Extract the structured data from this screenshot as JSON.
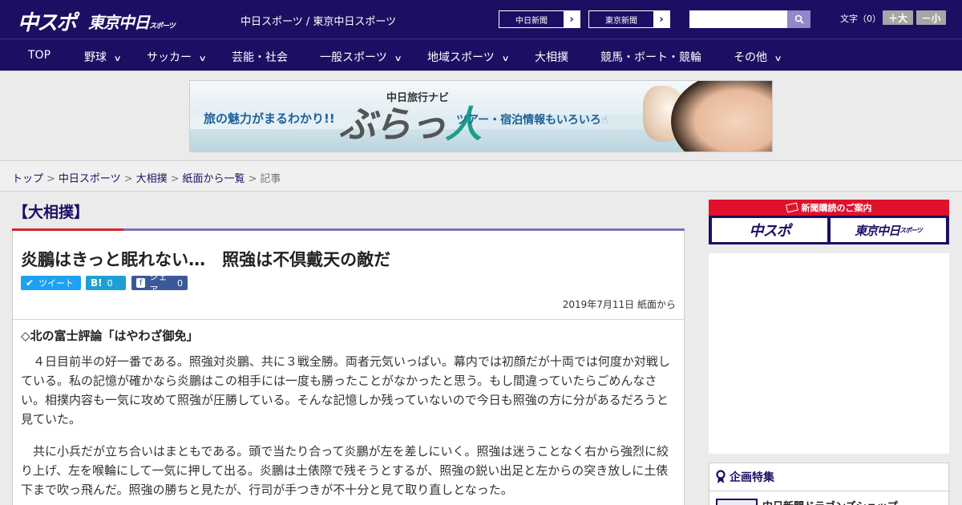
{
  "header": {
    "logo_chuspo": "中スポ",
    "logo_tokyo": "東京中日",
    "logo_tokyo_small": "スポーツ",
    "site_links": "中日スポーツ / 東京中日スポーツ",
    "btn_chunichi": "中日新聞",
    "btn_tokyo": "東京新聞",
    "search_placeholder": "",
    "moji_label": "文字（0）",
    "size_up": "＋大",
    "size_down": "－小"
  },
  "nav": {
    "items": [
      {
        "label": "TOP",
        "dropdown": false
      },
      {
        "label": "野球",
        "dropdown": true
      },
      {
        "label": "サッカー",
        "dropdown": true
      },
      {
        "label": "芸能・社会",
        "dropdown": false
      },
      {
        "label": "一般スポーツ",
        "dropdown": true
      },
      {
        "label": "地域スポーツ",
        "dropdown": true
      },
      {
        "label": "大相撲",
        "dropdown": false
      },
      {
        "label": "競馬・ボート・競輪",
        "dropdown": false
      },
      {
        "label": "その他",
        "dropdown": true
      }
    ]
  },
  "banner": {
    "subtitle": "中日旅行ナビ",
    "left_text": "旅の魅力がまるわかり!!",
    "logo_text": "ぶらっ",
    "logo_hito": "人",
    "right_text": "ツアー・宿泊情報もいろいろ"
  },
  "breadcrumb": {
    "items": [
      "トップ",
      "中日スポーツ",
      "大相撲",
      "紙面から一覧"
    ],
    "current": "記事"
  },
  "article": {
    "section": "【大相撲】",
    "headline": "炎鵬はきっと眠れない…　照強は不倶戴天の敵だ",
    "share_tweet": "ツイート",
    "share_hatena_icon": "B!",
    "share_hatena_count": "0",
    "share_fb_label": "シェア",
    "share_fb_count": "0",
    "date": "2019年7月11日 紙面から",
    "sub_heading": "◇北の富士評論「はやわざ御免」",
    "paragraphs": [
      "４日目前半の好一番である。照強対炎鵬、共に３戦全勝。両者元気いっぱい。幕内では初顔だが十両では何度か対戦している。私の記憶が確かなら炎鵬はこの相手には一度も勝ったことがなかったと思う。もし間違っていたらごめんなさい。相撲内容も一気に攻めて照強が圧勝している。そんな記憶しか残っていないので今日も照強の方に分があるだろうと見ていた。",
      "共に小兵だが立ち合いはまともである。頭で当たり合って炎鵬が左を差しにいく。照強は迷うことなく右から強烈に絞り上げ、左を喉輪にして一気に押して出る。炎鵬は土俵際で残そうとするが、照強の鋭い出足と左からの突き放しに土俵下まで吹っ飛んだ。照強の勝ちと見たが、行司が手つきが不十分と見て取り直しとなった。"
    ]
  },
  "sidebar": {
    "subs_head": "新聞購読のご案内",
    "subs_btn_1": "中スポ",
    "subs_btn_2": "東京中日",
    "subs_btn_2_small": "スポーツ",
    "feature_title": "企画特集",
    "feature_item": "中日新聞ドラゴンズショップ"
  }
}
